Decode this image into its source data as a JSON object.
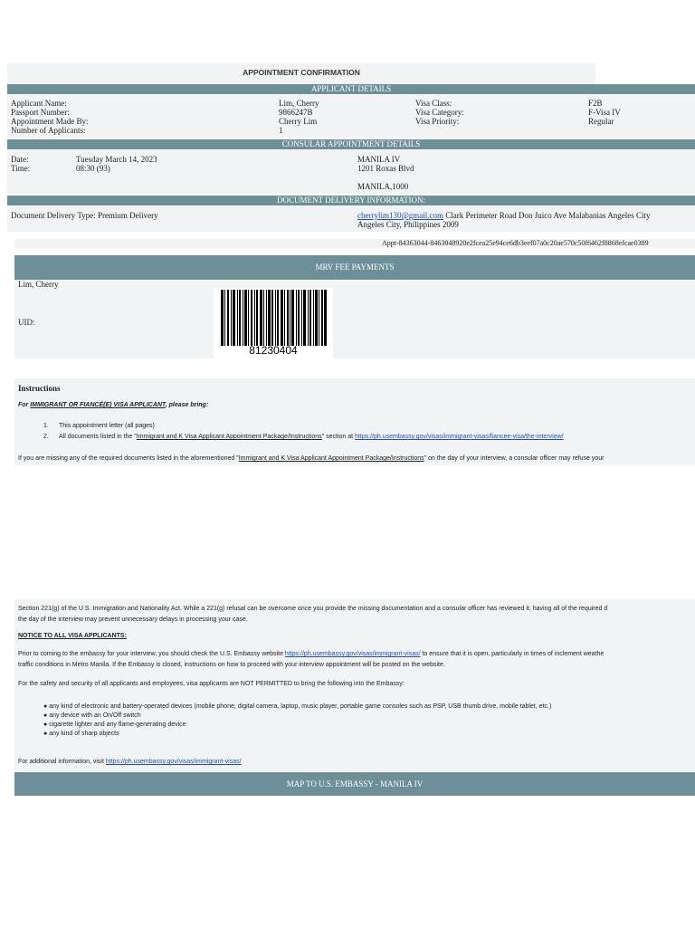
{
  "header": {
    "title": "APPOINTMENT CONFIRMATION"
  },
  "applicant": {
    "section_title": "APPLICANT DETAILS",
    "labels": [
      "Applicant Name:",
      "Passport Number:",
      "Appointment Made By:",
      "Number of Applicants:"
    ],
    "values": [
      "Lim, Cherry",
      "9866247B",
      "Cherry Lim",
      "1"
    ],
    "visa_labels": [
      "Visa Class:",
      "Visa Category:",
      "Visa Priority:"
    ],
    "visa_values": [
      "F2B",
      "F-Visa IV",
      "Regular"
    ]
  },
  "consular": {
    "section_title": "CONSULAR APPOINTMENT DETAILS",
    "date_label": "Date:",
    "date_value": "Tuesday March 14, 2023",
    "time_label": "Time:",
    "time_value": "08:30 (93)",
    "location_name": "MANILA IV",
    "address_line1": "1201 Roxas Blvd",
    "address_line2": "MANILA,1000"
  },
  "delivery": {
    "section_title": "DOCUMENT DELIVERY INFORMATION:",
    "type_label": "Document Delivery Type:",
    "type_value": "Premium Delivery",
    "email": "cherrylim130@gmail.com",
    "address_line1": "Clark Perimeter Road Don Juico Ave Malabanias Angeles City",
    "address_line2": "Angeles City, Philippines 2009"
  },
  "appt_id": "Appt-84363044-8463048920e2fcea25e94ce6db3eef07a0c20ae570c50f6462f8868efcae0389",
  "mrv": {
    "section_title": "MRV FEE PAYMENTS",
    "name": "Lim, Cherry",
    "uid_label": "UID:",
    "barcode_number": "81230404"
  },
  "instructions": {
    "heading": "Instructions",
    "for_prefix": "For ",
    "for_emph": "IMMIGRANT OR FIANCÉ(E) VISA APPLICANT",
    "for_suffix": ", please bring:",
    "item1_num": "1.",
    "item1": "This appointment letter (all pages)",
    "item2_num": "2.",
    "item2_a": "All documents listed in the \"",
    "item2_link": "Immigrant and K Visa Applicant Appointment Package/Instructions",
    "item2_b": "\" section at ",
    "item2_url": "https://ph.usembassy.gov/visas/immigrant-visas/fiancee-visa/the-interview/",
    "missing_a": "If you are missing any of the required documents listed in the aforementioned \"",
    "missing_link": "Immigrant and K Visa Applicant Appointment Package/Instructions",
    "missing_b": "\" on the day of your interview, a consular officer may refuse your"
  },
  "section221": {
    "line1": "Section 221(g) of the U.S. Immigration and Nationality Act.  While a 221(g) refusal can be overcome once you provide the missing documentation and a consular officer has reviewed it, having all of the required d",
    "line2": "the day of the interview may prevent unnecessary delays in processing your case."
  },
  "notice": {
    "heading": "NOTICE TO ALL VISA APPLICANTS:",
    "p1_a": "Prior to coming to the embassy for your interview, you should check the U.S. Embassy website ",
    "p1_url": "https://ph.usembassy.gov/visas/immigrant-visas/",
    "p1_b": "  to ensure that it is open, particularly in times of inclement weathe",
    "p1_line2": "traffic conditions in Metro Manila.   If the Embassy is closed, instructions on how to proceed with your interview appointment will be posted on the website.",
    "p2": "For the safety and security of all applicants and employees, visa applicants are NOT PERMITTED to bring the following into the Embassy:",
    "bullets": [
      "any kind of electronic and battery-operated devices (mobile phone, digital camera, laptop, music player, portable game consoles such as PSP, USB thumb drive, mobile tablet, etc.)",
      "any device with an On/Off switch",
      "cigarette lighter and any flame-generating device",
      "any kind of sharp objects"
    ],
    "additional_prefix": "For additional information, visit ",
    "additional_url": "https://ph.usembassy.gov/visas/immigrant-visas/"
  },
  "map": {
    "section_title": "MAP TO U.S. EMBASSY - MANILA IV"
  }
}
